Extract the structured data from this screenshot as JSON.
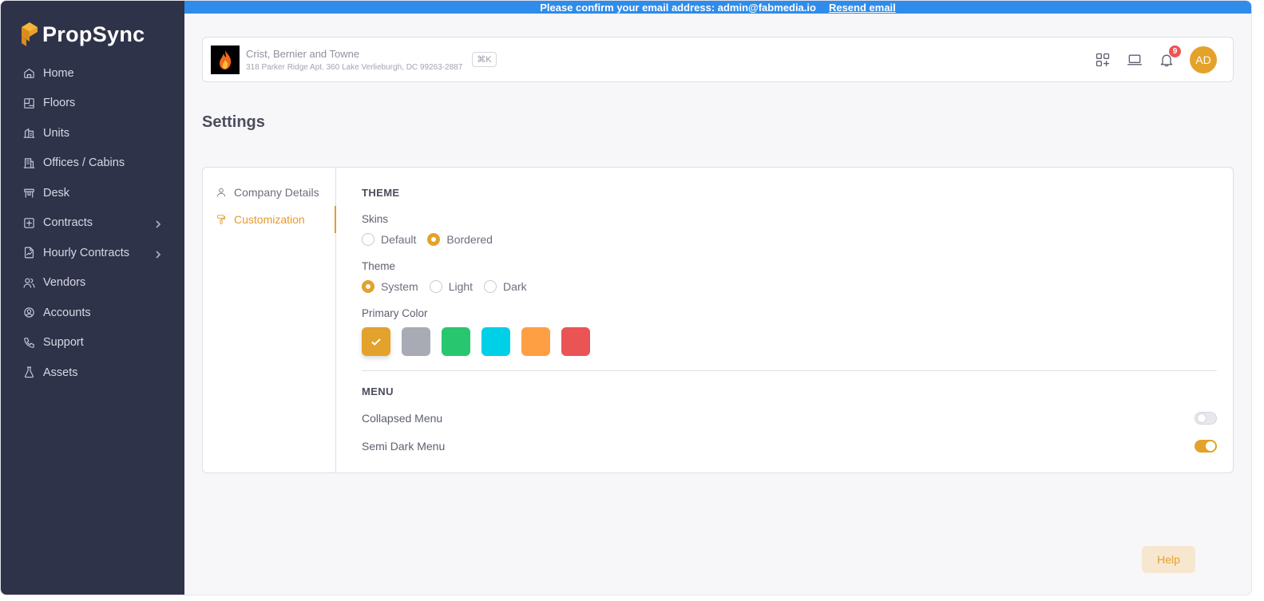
{
  "app": {
    "name": "PropSync"
  },
  "banner": {
    "message": "Please confirm your email address: admin@fabmedia.io",
    "link": "Resend email"
  },
  "sidebar": {
    "items": [
      {
        "label": "Home",
        "icon": "home-icon",
        "expandable": false
      },
      {
        "label": "Floors",
        "icon": "floors-icon",
        "expandable": false
      },
      {
        "label": "Units",
        "icon": "units-icon",
        "expandable": false
      },
      {
        "label": "Offices / Cabins",
        "icon": "offices-icon",
        "expandable": false
      },
      {
        "label": "Desk",
        "icon": "desk-icon",
        "expandable": false
      },
      {
        "label": "Contracts",
        "icon": "contracts-icon",
        "expandable": true
      },
      {
        "label": "Hourly Contracts",
        "icon": "hourly-contracts-icon",
        "expandable": true
      },
      {
        "label": "Vendors",
        "icon": "vendors-icon",
        "expandable": false
      },
      {
        "label": "Accounts",
        "icon": "accounts-icon",
        "expandable": false
      },
      {
        "label": "Support",
        "icon": "support-icon",
        "expandable": false
      },
      {
        "label": "Assets",
        "icon": "assets-icon",
        "expandable": false
      }
    ]
  },
  "header": {
    "company_name": "Crist, Bernier and Towne",
    "company_address": "318 Parker Ridge Apt. 360 Lake Verlieburgh, DC 99263-2887",
    "shortcut": "⌘K",
    "notification_count": "9",
    "avatar_initials": "AD"
  },
  "page": {
    "title": "Settings"
  },
  "settings_tabs": [
    {
      "label": "Company Details",
      "icon": "user-icon",
      "active": false
    },
    {
      "label": "Customization",
      "icon": "paint-roller-icon",
      "active": true
    }
  ],
  "theme_section": {
    "title": "THEME",
    "skins_label": "Skins",
    "skins": [
      {
        "label": "Default",
        "selected": false
      },
      {
        "label": "Bordered",
        "selected": true
      }
    ],
    "theme_label": "Theme",
    "themes": [
      {
        "label": "System",
        "selected": true
      },
      {
        "label": "Light",
        "selected": false
      },
      {
        "label": "Dark",
        "selected": false
      }
    ],
    "primary_color_label": "Primary Color",
    "colors": [
      {
        "hex": "#e3a22b",
        "selected": true
      },
      {
        "hex": "#a8aab4",
        "selected": false
      },
      {
        "hex": "#28c76f",
        "selected": false
      },
      {
        "hex": "#00cfe8",
        "selected": false
      },
      {
        "hex": "#ff9f43",
        "selected": false
      },
      {
        "hex": "#ea5455",
        "selected": false
      }
    ]
  },
  "menu_section": {
    "title": "MENU",
    "options": [
      {
        "label": "Collapsed Menu",
        "enabled": false
      },
      {
        "label": "Semi Dark Menu",
        "enabled": true
      }
    ]
  },
  "help": {
    "label": "Help"
  }
}
